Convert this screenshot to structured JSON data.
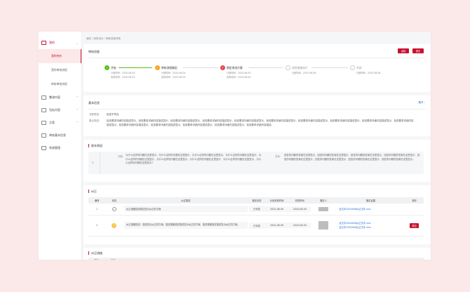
{
  "sidebar": {
    "items": [
      {
        "label": "我的",
        "icon": "document-icon",
        "active": true,
        "expanded": true,
        "children": [
          {
            "label": "我的待办",
            "active": true
          },
          {
            "label": "我的审核流程",
            "active": false
          },
          {
            "label": "审核审核流程",
            "active": false
          }
        ]
      },
      {
        "label": "整改内容",
        "icon": "list-icon",
        "active": false
      },
      {
        "label": "包括内容",
        "icon": "list-icon",
        "active": false
      },
      {
        "label": "方案",
        "icon": "list-icon",
        "active": false
      },
      {
        "label": "审核基本信息",
        "icon": "list-icon",
        "active": false
      },
      {
        "label": "系统管理",
        "icon": "gear-icon",
        "active": false
      }
    ]
  },
  "breadcrumb": "我的 / 我的待办 / 审核流程详情",
  "progress": {
    "title": "审核进度",
    "buttons": [
      "返回",
      "提交"
    ],
    "steps": [
      {
        "name": "开始",
        "status": "done",
        "color": "#52c41a",
        "plan": "计划时间：2020-06-03",
        "actual": "实际时间：2020-06-03"
      },
      {
        "name": "审核流程确定",
        "status": "done",
        "color": "#f5a623",
        "plan": "计划时间：2020-06-04",
        "actual": "实际时间：2020-06-04"
      },
      {
        "name": "制定改进方案",
        "status": "current",
        "color": "#e5484d",
        "plan": "计划时间：2020-06-05",
        "actual": "实际时间：2020-06-05"
      },
      {
        "name": "改进措施执行",
        "status": "todo",
        "color": "#cccccc",
        "plan": "计划时间：2020-06-06",
        "actual": ""
      },
      {
        "name": "关闭",
        "status": "todo",
        "color": "#cccccc",
        "plan": "计划时间：2020-06-08",
        "actual": ""
      }
    ]
  },
  "basic": {
    "title": "基本信息",
    "expand_label": "展开",
    "type_label": "流程类型：",
    "type_value": "检查不符合",
    "desc_label": "要点描述：",
    "desc_value": "检查要求详细内容描述显示，检查要求详细内容描述显示，检查要求详细内容描述显示，检查要求详细内容描述显示，检查要求详细内容描述显示，检查要求详细内容描述显示，检查要求详细内容描述显示，检查要求详细内容描述显示，检查要求详细内容描述显示，检查要求详细内容描述显示，检查要求详细内容描述显示，检查要求详细内容描述显示，检查要求详细内容描述显示，检查要求详细内容描述显示，检查要求详细内容描述。"
  },
  "root": {
    "title": "根本原因",
    "index": "1",
    "q_label": "问题：",
    "q_text": "为什么这样的问题在这里显示，为什么这样的问题在这里显示，为什么这样的问题在这里显示，为什么这样的问题在这里显示，为什么这样的问题在这里显示，为什么这样的问题在这里显示，为什么这样的问题在这里显示，为什么这样的问题在这里显示，为什么这样的问题在这里显示？",
    "a_label": "答案：",
    "a_text": "回答的问题的答案在这里显示，回答的问题的答案在这里显示，回答的问题的答案在这里显示，回答的问题的答案在这里显示，回答的问题的答案在这里显示，回答的问题的答案在这里显示，回答的问题的答案在这里显示，回答的问题的答案在这里显示。"
  },
  "rectify": {
    "title": "纠正",
    "headers": [
      "编号",
      "状态",
      "纠正描述",
      "落实状态",
      "计划完成时间",
      "完成时间",
      "落实人",
      "落实证据",
      "操作"
    ],
    "rows": [
      {
        "no": "1",
        "status_icon": "minus-circle-icon",
        "desc": "纠正措施描述描述显示纠正的方案",
        "state": "已完成",
        "plan": "2020-06-09",
        "done": "2020-06-09",
        "evidence": "证文件2020090纠正文件.xlsx",
        "action": ""
      },
      {
        "no": "2",
        "status_icon": "clock-icon",
        "desc": "纠正措施描述，描述显示纠正的方案。描述措施描述描述显示纠正的方案，描述措施描述描述显示纠正的方案。",
        "state": "已完成",
        "plan": "2020-06-09",
        "done": "2020-06-09",
        "evidence": "证文件2020090纠正文件.xlsx",
        "evidence2": "证文件2020090纠正文件.xlsx",
        "action": "提交"
      }
    ]
  },
  "prevent": {
    "title": "纠正措施",
    "headers": [
      "编号",
      "状态"
    ]
  },
  "colors": {
    "accent": "#c8102e",
    "link": "#2a6fd1"
  }
}
